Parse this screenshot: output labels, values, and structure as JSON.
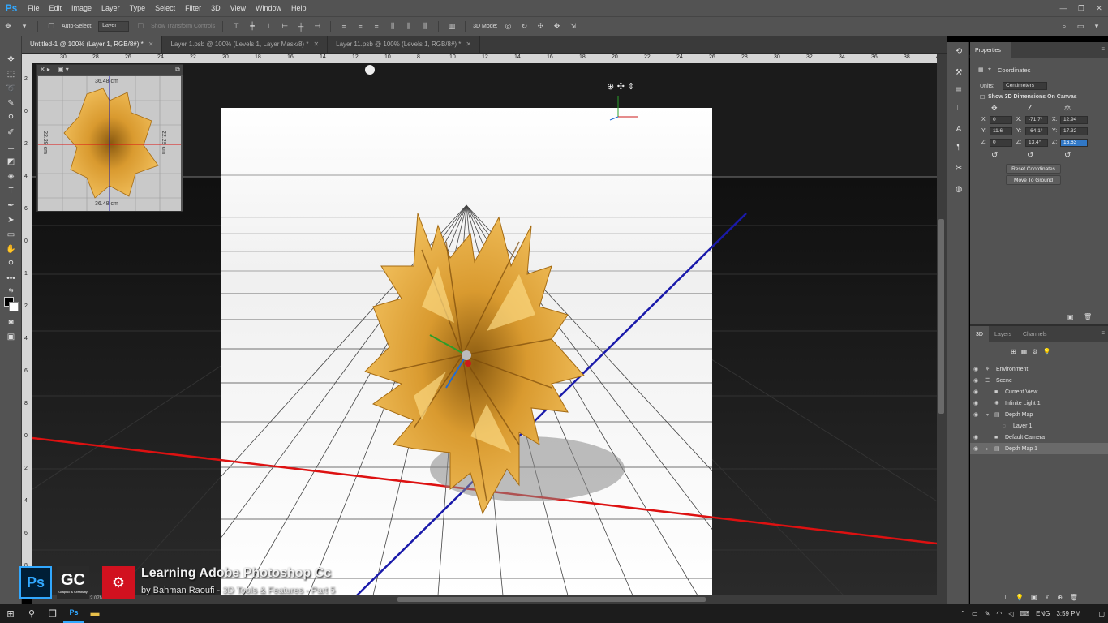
{
  "app": {
    "logo": "Ps"
  },
  "menu": [
    "File",
    "Edit",
    "Image",
    "Layer",
    "Type",
    "Select",
    "Filter",
    "3D",
    "View",
    "Window",
    "Help"
  ],
  "window_controls": [
    "minimize-icon",
    "restore-icon",
    "close-icon"
  ],
  "options_bar": {
    "auto_select_label": "Auto-Select:",
    "auto_select_value": "Layer",
    "show_transform_label": "Show Transform Controls",
    "mode_3d_label": "3D Mode:"
  },
  "tabs": [
    {
      "label": "Untitled-1 @ 100% (Layer 1, RGB/8#) *",
      "active": true
    },
    {
      "label": "Layer 1.psb @ 100% (Levels 1, Layer Mask/8) *",
      "active": false
    },
    {
      "label": "Layer 11.psb @ 100% (Levels 1, RGB/8#) *",
      "active": false
    }
  ],
  "ruler_top": [
    "30",
    "28",
    "26",
    "24",
    "22",
    "20",
    "18",
    "16",
    "14",
    "12",
    "10",
    "8",
    "10",
    "12",
    "14",
    "16",
    "18",
    "20",
    "22",
    "24",
    "26",
    "28",
    "30",
    "32",
    "34",
    "36",
    "38",
    "40",
    "42"
  ],
  "ruler_left": [
    "2",
    "0",
    "2",
    "4",
    "6",
    "0",
    "1",
    "2",
    "4",
    "6",
    "8",
    "0",
    "2",
    "4",
    "6",
    "8"
  ],
  "navigator": {
    "dim_top": "36.48 cm",
    "dim_bottom": "36.48 cm",
    "dim_left": "22.29 cm",
    "dim_right": "22.29 cm"
  },
  "properties": {
    "tab": "Properties",
    "section": "Coordinates",
    "units_label": "Units:",
    "units_value": "Centimeters",
    "show_dims_label": "Show 3D Dimensions On Canvas",
    "pos": {
      "x": "0",
      "y": "11.6",
      "z": "0"
    },
    "rot": {
      "x": "-71.7°",
      "y": "-64.1°",
      "z": "13.4°"
    },
    "scale": {
      "x": "12.94",
      "y": "17.32",
      "z": "16.63"
    },
    "axis_labels": {
      "x": "X:",
      "y": "Y:",
      "z": "Z:"
    },
    "reset_btn": "Reset Coordinates",
    "ground_btn": "Move To Ground"
  },
  "panel3d": {
    "tabs": [
      "3D",
      "Layers",
      "Channels"
    ],
    "items": [
      {
        "label": "Environment",
        "indent": 0,
        "icon": "environment-icon"
      },
      {
        "label": "Scene",
        "indent": 0,
        "icon": "scene-icon"
      },
      {
        "label": "Current View",
        "indent": 1,
        "icon": "camera-icon"
      },
      {
        "label": "Infinite Light 1",
        "indent": 1,
        "icon": "light-icon"
      },
      {
        "label": "Depth Map",
        "indent": 1,
        "icon": "mesh-icon"
      },
      {
        "label": "Layer 1",
        "indent": 2,
        "icon": "material-icon"
      },
      {
        "label": "Default Camera",
        "indent": 1,
        "icon": "camera-icon"
      },
      {
        "label": "Depth Map 1",
        "indent": 1,
        "icon": "mesh-icon",
        "selected": true
      }
    ]
  },
  "status": {
    "zoom": "100%",
    "doc": "Doc: 2.07M/25.5M"
  },
  "branding": {
    "title": "Learning Adobe Photoshop Cc",
    "subtitle": "by Bahman Raoufi - 3D Tools & Features - Part 5",
    "ps_badge": "Ps",
    "gc_badge": "GC",
    "gc_caption": "Graphic & Creativity"
  },
  "taskbar": {
    "lang": "ENG",
    "time": "3:59 PM"
  },
  "colors": {
    "ps_blue": "#31a8ff",
    "gold": "#e0a93c",
    "axis_red": "#dd1111",
    "axis_blue": "#1a1aaa"
  }
}
